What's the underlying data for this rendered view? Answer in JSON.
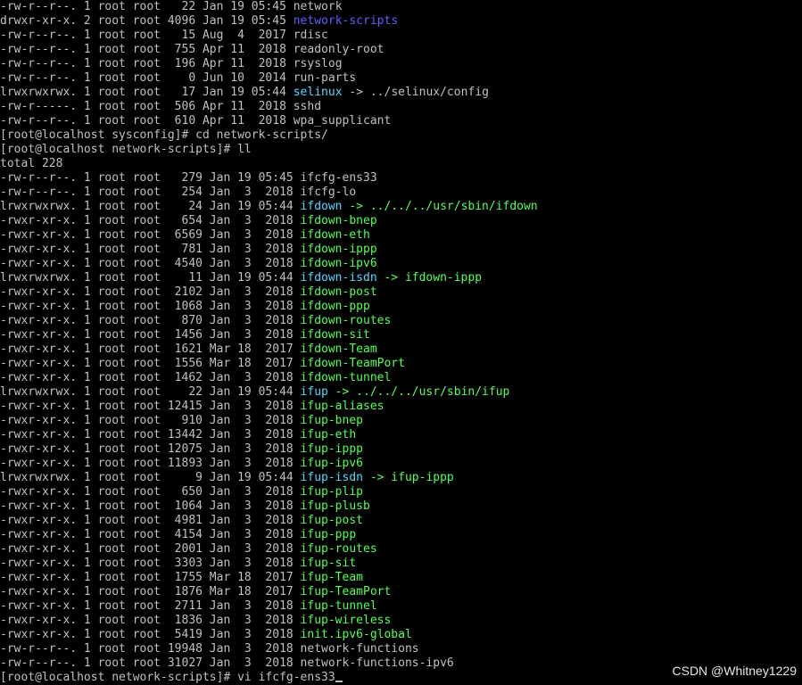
{
  "colors": {
    "background": "#000000",
    "text": "#c0c0c0",
    "directory": "#5f5fff",
    "symlink": "#55d7ff",
    "executable": "#55ff55"
  },
  "terminal": {
    "lines": [
      {
        "text": "-rw-r--r--. 1 root root   22 Jan 19 05:45 ",
        "name": "network",
        "type": "file"
      },
      {
        "text": "drwxr-xr-x. 2 root root 4096 Jan 19 05:45 ",
        "name": "network-scripts",
        "type": "dir"
      },
      {
        "text": "-rw-r--r--. 1 root root   15 Aug  4  2017 ",
        "name": "rdisc",
        "type": "file"
      },
      {
        "text": "-rw-r--r--. 1 root root  755 Apr 11  2018 ",
        "name": "readonly-root",
        "type": "file"
      },
      {
        "text": "-rw-r--r--. 1 root root  196 Apr 11  2018 ",
        "name": "rsyslog",
        "type": "file"
      },
      {
        "text": "-rw-r--r--. 1 root root    0 Jun 10  2014 ",
        "name": "run-parts",
        "type": "file"
      },
      {
        "text": "lrwxrwxrwx. 1 root root   17 Jan 19 05:44 ",
        "name": "selinux",
        "type": "link",
        "target": " -> ../selinux/config",
        "target_type": "file"
      },
      {
        "text": "-rw-r-----. 1 root root  506 Apr 11  2018 ",
        "name": "sshd",
        "type": "file"
      },
      {
        "text": "-rw-r--r--. 1 root root  610 Apr 11  2018 ",
        "name": "wpa_supplicant",
        "type": "file"
      },
      {
        "text": "[root@localhost sysconfig]# cd network-scripts/",
        "type": "plain"
      },
      {
        "text": "[root@localhost network-scripts]# ll",
        "type": "plain"
      },
      {
        "text": "total 228",
        "type": "plain"
      },
      {
        "text": "-rw-r--r--. 1 root root   279 Jan 19 05:45 ",
        "name": "ifcfg-ens33",
        "type": "file"
      },
      {
        "text": "-rw-r--r--. 1 root root   254 Jan  3  2018 ",
        "name": "ifcfg-lo",
        "type": "file"
      },
      {
        "text": "lrwxrwxrwx. 1 root root    24 Jan 19 05:44 ",
        "name": "ifdown",
        "type": "link",
        "target": " -> ../../../usr/sbin/ifdown",
        "target_type": "exec"
      },
      {
        "text": "-rwxr-xr-x. 1 root root   654 Jan  3  2018 ",
        "name": "ifdown-bnep",
        "type": "exec"
      },
      {
        "text": "-rwxr-xr-x. 1 root root  6569 Jan  3  2018 ",
        "name": "ifdown-eth",
        "type": "exec"
      },
      {
        "text": "-rwxr-xr-x. 1 root root   781 Jan  3  2018 ",
        "name": "ifdown-ippp",
        "type": "exec"
      },
      {
        "text": "-rwxr-xr-x. 1 root root  4540 Jan  3  2018 ",
        "name": "ifdown-ipv6",
        "type": "exec"
      },
      {
        "text": "lrwxrwxrwx. 1 root root    11 Jan 19 05:44 ",
        "name": "ifdown-isdn",
        "type": "link",
        "target": " -> ifdown-ippp",
        "target_type": "exec"
      },
      {
        "text": "-rwxr-xr-x. 1 root root  2102 Jan  3  2018 ",
        "name": "ifdown-post",
        "type": "exec"
      },
      {
        "text": "-rwxr-xr-x. 1 root root  1068 Jan  3  2018 ",
        "name": "ifdown-ppp",
        "type": "exec"
      },
      {
        "text": "-rwxr-xr-x. 1 root root   870 Jan  3  2018 ",
        "name": "ifdown-routes",
        "type": "exec"
      },
      {
        "text": "-rwxr-xr-x. 1 root root  1456 Jan  3  2018 ",
        "name": "ifdown-sit",
        "type": "exec"
      },
      {
        "text": "-rwxr-xr-x. 1 root root  1621 Mar 18  2017 ",
        "name": "ifdown-Team",
        "type": "exec"
      },
      {
        "text": "-rwxr-xr-x. 1 root root  1556 Mar 18  2017 ",
        "name": "ifdown-TeamPort",
        "type": "exec"
      },
      {
        "text": "-rwxr-xr-x. 1 root root  1462 Jan  3  2018 ",
        "name": "ifdown-tunnel",
        "type": "exec"
      },
      {
        "text": "lrwxrwxrwx. 1 root root    22 Jan 19 05:44 ",
        "name": "ifup",
        "type": "link",
        "target": " -> ../../../usr/sbin/ifup",
        "target_type": "exec"
      },
      {
        "text": "-rwxr-xr-x. 1 root root 12415 Jan  3  2018 ",
        "name": "ifup-aliases",
        "type": "exec"
      },
      {
        "text": "-rwxr-xr-x. 1 root root   910 Jan  3  2018 ",
        "name": "ifup-bnep",
        "type": "exec"
      },
      {
        "text": "-rwxr-xr-x. 1 root root 13442 Jan  3  2018 ",
        "name": "ifup-eth",
        "type": "exec"
      },
      {
        "text": "-rwxr-xr-x. 1 root root 12075 Jan  3  2018 ",
        "name": "ifup-ippp",
        "type": "exec"
      },
      {
        "text": "-rwxr-xr-x. 1 root root 11893 Jan  3  2018 ",
        "name": "ifup-ipv6",
        "type": "exec"
      },
      {
        "text": "lrwxrwxrwx. 1 root root     9 Jan 19 05:44 ",
        "name": "ifup-isdn",
        "type": "link",
        "target": " -> ifup-ippp",
        "target_type": "exec"
      },
      {
        "text": "-rwxr-xr-x. 1 root root   650 Jan  3  2018 ",
        "name": "ifup-plip",
        "type": "exec"
      },
      {
        "text": "-rwxr-xr-x. 1 root root  1064 Jan  3  2018 ",
        "name": "ifup-plusb",
        "type": "exec"
      },
      {
        "text": "-rwxr-xr-x. 1 root root  4981 Jan  3  2018 ",
        "name": "ifup-post",
        "type": "exec"
      },
      {
        "text": "-rwxr-xr-x. 1 root root  4154 Jan  3  2018 ",
        "name": "ifup-ppp",
        "type": "exec"
      },
      {
        "text": "-rwxr-xr-x. 1 root root  2001 Jan  3  2018 ",
        "name": "ifup-routes",
        "type": "exec"
      },
      {
        "text": "-rwxr-xr-x. 1 root root  3303 Jan  3  2018 ",
        "name": "ifup-sit",
        "type": "exec"
      },
      {
        "text": "-rwxr-xr-x. 1 root root  1755 Mar 18  2017 ",
        "name": "ifup-Team",
        "type": "exec"
      },
      {
        "text": "-rwxr-xr-x. 1 root root  1876 Mar 18  2017 ",
        "name": "ifup-TeamPort",
        "type": "exec"
      },
      {
        "text": "-rwxr-xr-x. 1 root root  2711 Jan  3  2018 ",
        "name": "ifup-tunnel",
        "type": "exec"
      },
      {
        "text": "-rwxr-xr-x. 1 root root  1836 Jan  3  2018 ",
        "name": "ifup-wireless",
        "type": "exec"
      },
      {
        "text": "-rwxr-xr-x. 1 root root  5419 Jan  3  2018 ",
        "name": "init.ipv6-global",
        "type": "exec"
      },
      {
        "text": "-rw-r--r--. 1 root root 19948 Jan  3  2018 ",
        "name": "network-functions",
        "type": "file"
      },
      {
        "text": "-rw-r--r--. 1 root root 31027 Jan  3  2018 ",
        "name": "network-functions-ipv6",
        "type": "file"
      }
    ],
    "prompt": "[root@localhost network-scripts]# ",
    "command": "vi ifcfg-ens33"
  },
  "watermark": {
    "text": "CSDN @Whitney1229"
  }
}
